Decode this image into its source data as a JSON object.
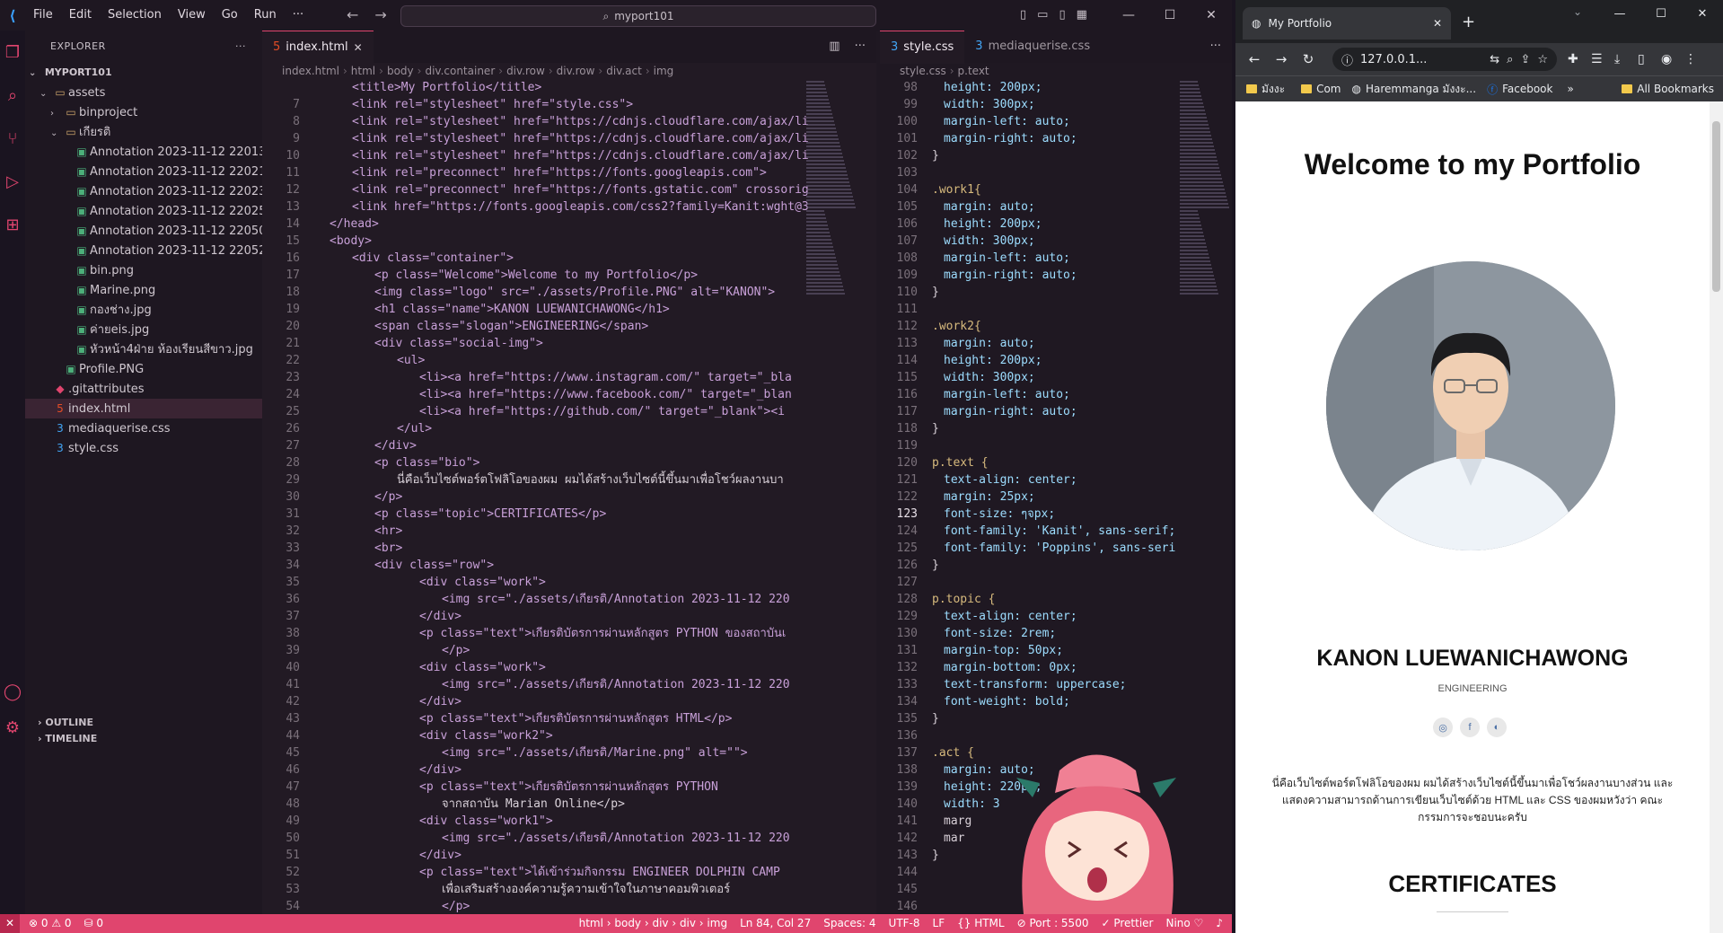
{
  "vscode": {
    "menu": [
      "File",
      "Edit",
      "Selection",
      "View",
      "Go",
      "Run",
      "···"
    ],
    "search": "myport101",
    "explorer": {
      "title": "EXPLORER",
      "project": "MYPORT101",
      "tree": [
        {
          "label": "assets",
          "level": 1,
          "kind": "folder",
          "open": true
        },
        {
          "label": "binproject",
          "level": 2,
          "kind": "folder",
          "open": false
        },
        {
          "label": "เกียรติ",
          "level": 2,
          "kind": "folder",
          "open": true
        },
        {
          "label": "Annotation 2023-11-12 22013...",
          "level": 3,
          "kind": "image"
        },
        {
          "label": "Annotation 2023-11-12 22021...",
          "level": 3,
          "kind": "image"
        },
        {
          "label": "Annotation 2023-11-12 22023...",
          "level": 3,
          "kind": "image"
        },
        {
          "label": "Annotation 2023-11-12 22025...",
          "level": 3,
          "kind": "image"
        },
        {
          "label": "Annotation 2023-11-12 22050...",
          "level": 3,
          "kind": "image"
        },
        {
          "label": "Annotation 2023-11-12 22052...",
          "level": 3,
          "kind": "image"
        },
        {
          "label": "bin.png",
          "level": 3,
          "kind": "image"
        },
        {
          "label": "Marine.png",
          "level": 3,
          "kind": "image"
        },
        {
          "label": "กองช่าง.jpg",
          "level": 3,
          "kind": "image"
        },
        {
          "label": "ค่ายeis.jpg",
          "level": 3,
          "kind": "image"
        },
        {
          "label": "หัวหน้า4ฝ่าย ห้องเรียนสีขาว.jpg",
          "level": 3,
          "kind": "image"
        },
        {
          "label": "Profile.PNG",
          "level": 2,
          "kind": "image"
        },
        {
          "label": ".gitattributes",
          "level": 1,
          "kind": "git"
        },
        {
          "label": "index.html",
          "level": 1,
          "kind": "html",
          "active": true
        },
        {
          "label": "mediaquerise.css",
          "level": 1,
          "kind": "css"
        },
        {
          "label": "style.css",
          "level": 1,
          "kind": "css"
        }
      ],
      "outline": "OUTLINE",
      "timeline": "TIMELINE"
    },
    "editor_left": {
      "tab": "index.html",
      "breadcrumbs": [
        "index.html",
        "html",
        "body",
        "div.container",
        "div.row",
        "div.row",
        "div.act",
        "img"
      ],
      "lines": [
        {
          "n": "",
          "i": 2,
          "t": "<title>My Portfolio</title>"
        },
        {
          "n": "7",
          "i": 2,
          "t": "<link rel=\"stylesheet\" href=\"style.css\">"
        },
        {
          "n": "8",
          "i": 2,
          "t": "<link rel=\"stylesheet\" href=\"https://cdnjs.cloudflare.com/ajax/li"
        },
        {
          "n": "9",
          "i": 2,
          "t": "<link rel=\"stylesheet\" href=\"https://cdnjs.cloudflare.com/ajax/li"
        },
        {
          "n": "10",
          "i": 2,
          "t": "<link rel=\"stylesheet\" href=\"https://cdnjs.cloudflare.com/ajax/li"
        },
        {
          "n": "11",
          "i": 2,
          "t": "<link rel=\"preconnect\" href=\"https://fonts.googleapis.com\">"
        },
        {
          "n": "12",
          "i": 2,
          "t": "<link rel=\"preconnect\" href=\"https://fonts.gstatic.com\" crossorig"
        },
        {
          "n": "13",
          "i": 2,
          "t": "<link href=\"https://fonts.googleapis.com/css2?family=Kanit:wght@3"
        },
        {
          "n": "14",
          "i": 1,
          "t": "</head>"
        },
        {
          "n": "15",
          "i": 1,
          "t": "<body>"
        },
        {
          "n": "16",
          "i": 2,
          "t": "<div class=\"container\">"
        },
        {
          "n": "17",
          "i": 3,
          "t": "<p class=\"Welcome\">Welcome to my Portfolio</p>"
        },
        {
          "n": "18",
          "i": 3,
          "t": "<img class=\"logo\" src=\"./assets/Profile.PNG\" alt=\"KANON\">"
        },
        {
          "n": "19",
          "i": 3,
          "t": "<h1 class=\"name\">KANON LUEWANICHAWONG</h1>"
        },
        {
          "n": "20",
          "i": 3,
          "t": "<span class=\"slogan\">ENGINEERING</span>"
        },
        {
          "n": "21",
          "i": 3,
          "t": "<div class=\"social-img\">"
        },
        {
          "n": "22",
          "i": 4,
          "t": "<ul>"
        },
        {
          "n": "23",
          "i": 5,
          "t": "<li><a href=\"https://www.instagram.com/\" target=\"_bla"
        },
        {
          "n": "24",
          "i": 5,
          "t": "<li><a href=\"https://www.facebook.com/\" target=\"_blan"
        },
        {
          "n": "25",
          "i": 5,
          "t": "<li><a href=\"https://github.com/\" target=\"_blank\"><i"
        },
        {
          "n": "26",
          "i": 4,
          "t": "</ul>"
        },
        {
          "n": "27",
          "i": 3,
          "t": "</div>"
        },
        {
          "n": "28",
          "i": 3,
          "t": "<p class=\"bio\">"
        },
        {
          "n": "29",
          "i": 4,
          "t": "นี่คือเว็บไซต์พอร์ตโฟลิโอของผม ผมได้สร้างเว็บไซต์นี้ขึ้นมาเพื่อโชว์ผลงานบา"
        },
        {
          "n": "30",
          "i": 3,
          "t": "</p>"
        },
        {
          "n": "31",
          "i": 3,
          "t": "<p class=\"topic\">CERTIFICATES</p>"
        },
        {
          "n": "32",
          "i": 3,
          "t": "<hr>"
        },
        {
          "n": "33",
          "i": 3,
          "t": "<br>"
        },
        {
          "n": "34",
          "i": 3,
          "t": "<div class=\"row\">"
        },
        {
          "n": "35",
          "i": 5,
          "t": "<div class=\"work\">"
        },
        {
          "n": "36",
          "i": 6,
          "t": "<img src=\"./assets/เกียรติ/Annotation 2023-11-12 220"
        },
        {
          "n": "37",
          "i": 5,
          "t": "</div>"
        },
        {
          "n": "38",
          "i": 5,
          "t": "<p class=\"text\">เกียรติบัตรการผ่านหลักสูตร PYTHON ของสถาบันเ"
        },
        {
          "n": "39",
          "i": 6,
          "t": "</p>"
        },
        {
          "n": "40",
          "i": 5,
          "t": "<div class=\"work\">"
        },
        {
          "n": "41",
          "i": 6,
          "t": "<img src=\"./assets/เกียรติ/Annotation 2023-11-12 220"
        },
        {
          "n": "42",
          "i": 5,
          "t": "</div>"
        },
        {
          "n": "43",
          "i": 5,
          "t": "<p class=\"text\">เกียรติบัตรการผ่านหลักสูตร HTML</p>"
        },
        {
          "n": "44",
          "i": 5,
          "t": "<div class=\"work2\">"
        },
        {
          "n": "45",
          "i": 6,
          "t": "<img src=\"./assets/เกียรติ/Marine.png\" alt=\"\">"
        },
        {
          "n": "46",
          "i": 5,
          "t": "</div>"
        },
        {
          "n": "47",
          "i": 5,
          "t": "<p class=\"text\">เกียรติบัตรการผ่านหลักสูตร PYTHON"
        },
        {
          "n": "48",
          "i": 6,
          "t": "จากสถาบัน Marian Online</p>"
        },
        {
          "n": "49",
          "i": 5,
          "t": "<div class=\"work1\">"
        },
        {
          "n": "50",
          "i": 6,
          "t": "<img src=\"./assets/เกียรติ/Annotation 2023-11-12 220"
        },
        {
          "n": "51",
          "i": 5,
          "t": "</div>"
        },
        {
          "n": "52",
          "i": 5,
          "t": "<p class=\"text\">ได้เข้าร่วมกิจกรรม ENGINEER DOLPHIN CAMP"
        },
        {
          "n": "53",
          "i": 6,
          "t": "เพื่อเสริมสร้างองค์ความรู้ความเข้าใจในภาษาคอมพิวเตอร์"
        },
        {
          "n": "54",
          "i": 6,
          "t": "</p>"
        }
      ]
    },
    "editor_right": {
      "tabs": [
        "style.css",
        "mediaquerise.css"
      ],
      "breadcrumbs": [
        "style.css",
        "p.text"
      ],
      "lines": [
        {
          "n": "98",
          "i": 1,
          "t": "height: 200px;"
        },
        {
          "n": "99",
          "i": 1,
          "t": "width: 300px;"
        },
        {
          "n": "100",
          "i": 1,
          "t": "margin-left: auto;"
        },
        {
          "n": "101",
          "i": 1,
          "t": "margin-right: auto;"
        },
        {
          "n": "102",
          "i": 0,
          "t": "}"
        },
        {
          "n": "103",
          "i": 0,
          "t": ""
        },
        {
          "n": "104",
          "i": 0,
          "t": ".work1{"
        },
        {
          "n": "105",
          "i": 1,
          "t": "margin: auto;"
        },
        {
          "n": "106",
          "i": 1,
          "t": "height: 200px;"
        },
        {
          "n": "107",
          "i": 1,
          "t": "width: 300px;"
        },
        {
          "n": "108",
          "i": 1,
          "t": "margin-left: auto;"
        },
        {
          "n": "109",
          "i": 1,
          "t": "margin-right: auto;"
        },
        {
          "n": "110",
          "i": 0,
          "t": "}"
        },
        {
          "n": "111",
          "i": 0,
          "t": ""
        },
        {
          "n": "112",
          "i": 0,
          "t": ".work2{"
        },
        {
          "n": "113",
          "i": 1,
          "t": "margin: auto;"
        },
        {
          "n": "114",
          "i": 1,
          "t": "height: 200px;"
        },
        {
          "n": "115",
          "i": 1,
          "t": "width: 300px;"
        },
        {
          "n": "116",
          "i": 1,
          "t": "margin-left: auto;"
        },
        {
          "n": "117",
          "i": 1,
          "t": "margin-right: auto;"
        },
        {
          "n": "118",
          "i": 0,
          "t": "}"
        },
        {
          "n": "119",
          "i": 0,
          "t": ""
        },
        {
          "n": "120",
          "i": 0,
          "t": "p.text {"
        },
        {
          "n": "121",
          "i": 1,
          "t": "text-align: center;"
        },
        {
          "n": "122",
          "i": 1,
          "t": "margin: 25px;"
        },
        {
          "n": "123",
          "i": 1,
          "t": "font-size: ๆจpx;"
        },
        {
          "n": "124",
          "i": 1,
          "t": "font-family: 'Kanit', sans-serif;"
        },
        {
          "n": "125",
          "i": 1,
          "t": "font-family: 'Poppins', sans-seri"
        },
        {
          "n": "126",
          "i": 0,
          "t": "}"
        },
        {
          "n": "127",
          "i": 0,
          "t": ""
        },
        {
          "n": "128",
          "i": 0,
          "t": "p.topic {"
        },
        {
          "n": "129",
          "i": 1,
          "t": "text-align: center;"
        },
        {
          "n": "130",
          "i": 1,
          "t": "font-size: 2rem;"
        },
        {
          "n": "131",
          "i": 1,
          "t": "margin-top: 50px;"
        },
        {
          "n": "132",
          "i": 1,
          "t": "margin-bottom: 0px;"
        },
        {
          "n": "133",
          "i": 1,
          "t": "text-transform: uppercase;"
        },
        {
          "n": "134",
          "i": 1,
          "t": "font-weight: bold;"
        },
        {
          "n": "135",
          "i": 0,
          "t": "}"
        },
        {
          "n": "136",
          "i": 0,
          "t": ""
        },
        {
          "n": "137",
          "i": 0,
          "t": ".act {"
        },
        {
          "n": "138",
          "i": 1,
          "t": "margin: auto;"
        },
        {
          "n": "139",
          "i": 1,
          "t": "height: 220px;"
        },
        {
          "n": "140",
          "i": 1,
          "t": "width: 3"
        },
        {
          "n": "141",
          "i": 1,
          "t": "marg"
        },
        {
          "n": "142",
          "i": 1,
          "t": "mar"
        },
        {
          "n": "143",
          "i": 0,
          "t": "}"
        },
        {
          "n": "144",
          "i": 0,
          "t": ""
        },
        {
          "n": "145",
          "i": 0,
          "t": ""
        },
        {
          "n": "146",
          "i": 0,
          "t": ""
        }
      ]
    },
    "status": {
      "remote": "✕",
      "problems": "⊗ 0 ⚠ 0",
      "ports": "⛁ 0",
      "path": "html › body › div › div › img",
      "cursor": "Ln 84, Col 27",
      "spaces": "Spaces: 4",
      "encoding": "UTF-8",
      "eol": "LF",
      "language": "{} HTML",
      "port": "⊘ Port : 5500",
      "prettier": "✓ Prettier",
      "user": "Nino ♡",
      "bell": "♪"
    }
  },
  "chrome": {
    "tab_title": "My Portfolio",
    "url": "127.0.0.1...",
    "bookmarks": [
      "มังงะ",
      "Com",
      "Haremmanga มังงะ...",
      "Facebook"
    ],
    "all_bookmarks": "All Bookmarks"
  },
  "portfolio": {
    "welcome": "Welcome to my Portfolio",
    "name": "KANON LUEWANICHAWONG",
    "slogan": "ENGINEERING",
    "bio": "นี่คือเว็บไซต์พอร์ตโฟลิโอของผม ผมได้สร้างเว็บไซต์นี้ขึ้นมาเพื่อโชว์ผลงานบางส่วน และแสดงความสามารถด้านการเขียนเว็บไซต์ด้วย HTML และ CSS ของผมหวังว่า คณะกรรมการจะชอบนะครับ",
    "topic": "CERTIFICATES"
  },
  "colors": {
    "accent": "#e0456e",
    "tag": "#569cd6",
    "attr": "#9cdcfe",
    "string": "#ce9178",
    "selector": "#d7ba7d"
  }
}
